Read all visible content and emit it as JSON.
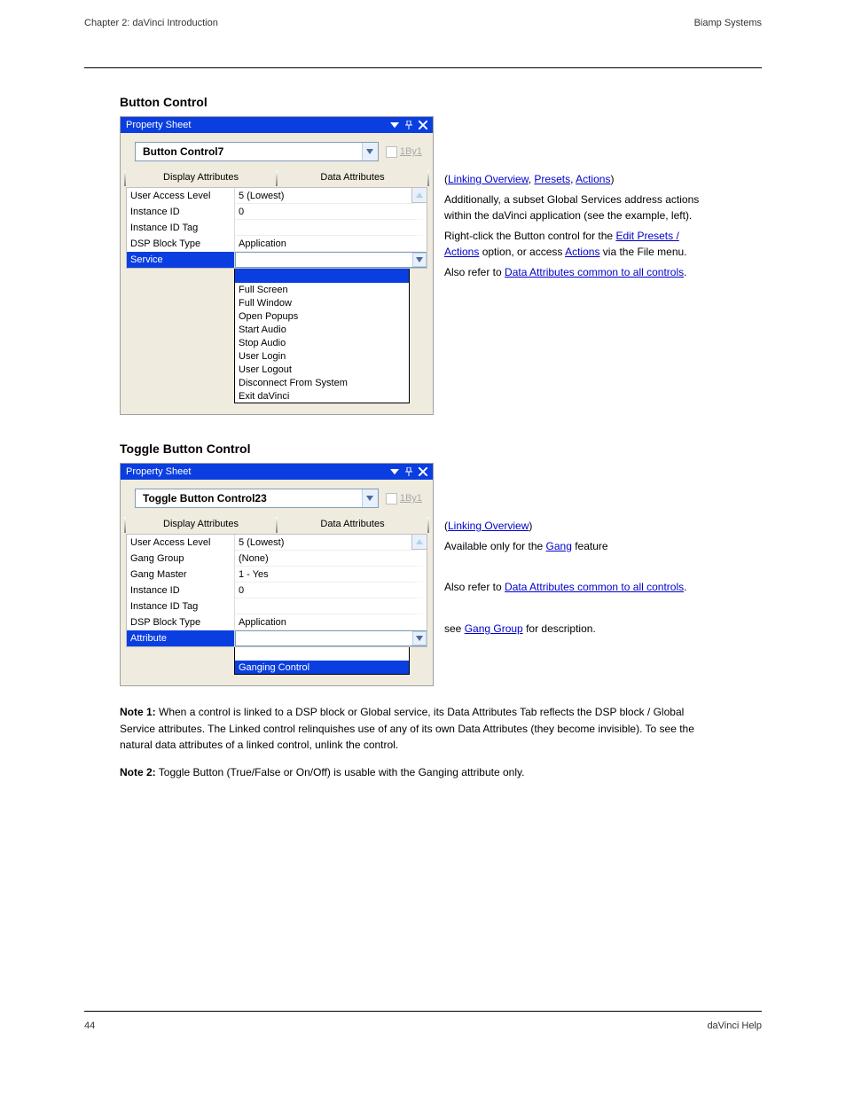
{
  "header": {
    "left": "Chapter 2: daVinci Introduction",
    "right": "Biamp Systems"
  },
  "footer": {
    "left": "44",
    "right": "daVinci Help"
  },
  "section1": {
    "title": "Button Control",
    "desc_parts": {
      "p1_a": "(",
      "p1_link1": "Linking Overview",
      "p1_b": ", ",
      "p1_link2": "Presets",
      "p1_c": ", ",
      "p1_link3": "Actions",
      "p1_d": ")",
      "p2": "Additionally, a subset Global Services address actions within the daVinci application (see the example, left).",
      "p3_a": "Right-click the Button control for the ",
      "p3_link": "Edit Presets / Actions",
      "p3_b": " option, or access ",
      "p3_link2": "Actions",
      "p3_c": " via the File menu.",
      "p4_a": "Also refer to  ",
      "p4_link": "Data Attributes common to all controls",
      "p4_b": "."
    }
  },
  "ps1": {
    "title": "Property Sheet",
    "combo": "Button Control7",
    "chk_label": "1By1",
    "tab1": "Display Attributes",
    "tab2": "Data Attributes",
    "rows": [
      {
        "label": "User Access Level",
        "value": "5 (Lowest)"
      },
      {
        "label": "Instance ID",
        "value": "0"
      },
      {
        "label": "Instance ID Tag",
        "value": ""
      },
      {
        "label": "DSP Block Type",
        "value": "Application"
      },
      {
        "label": "Service",
        "value": "",
        "sel": true
      }
    ],
    "dropdown": [
      "Full Screen",
      "Full Window",
      "Open Popups",
      "Start Audio",
      "Stop Audio",
      "User Login",
      "User Logout",
      "Disconnect From System",
      "Exit daVinci"
    ]
  },
  "section2": {
    "title": "Toggle Button Control",
    "desc_parts": {
      "p1_a": "(",
      "p1_link1": "Linking Overview",
      "p1_b": ")",
      "p2_a": "Available only for the ",
      "p2_link": "Gang",
      "p2_b": " feature",
      "p3_a": "Also refer to ",
      "p3_link": "Data Attributes common to all controls",
      "p3_b": ".",
      "p4_a": "see ",
      "p4_link": "Gang Group",
      "p4_b": " for description."
    }
  },
  "ps2": {
    "title": "Property Sheet",
    "combo": "Toggle Button Control23",
    "chk_label": "1By1",
    "tab1": "Display Attributes",
    "tab2": "Data Attributes",
    "rows": [
      {
        "label": "User Access Level",
        "value": "5 (Lowest)"
      },
      {
        "label": "Gang Group",
        "value": "(None)"
      },
      {
        "label": "Gang Master",
        "value": "1 - Yes"
      },
      {
        "label": "Instance ID",
        "value": "0"
      },
      {
        "label": "Instance ID Tag",
        "value": ""
      },
      {
        "label": "DSP Block Type",
        "value": "Application"
      },
      {
        "label": "Attribute",
        "value": "",
        "sel": true
      }
    ],
    "dropdown": [
      {
        "text": "",
        "sel": false
      },
      {
        "text": "Ganging Control",
        "sel": true
      }
    ]
  },
  "notes": {
    "p1_label": "Note 1:",
    "p1_text": " When a control is linked to a DSP block or Global service, its Data Attributes Tab reflects the DSP block / Global Service attributes. The Linked control relinquishes use of any of its own Data Attributes (they become invisible). To see the natural data attributes of a linked control, unlink the control.",
    "p2_label": "Note 2:",
    "p2_text": " Toggle Button (True/False or On/Off) is usable with the Ganging attribute only."
  }
}
